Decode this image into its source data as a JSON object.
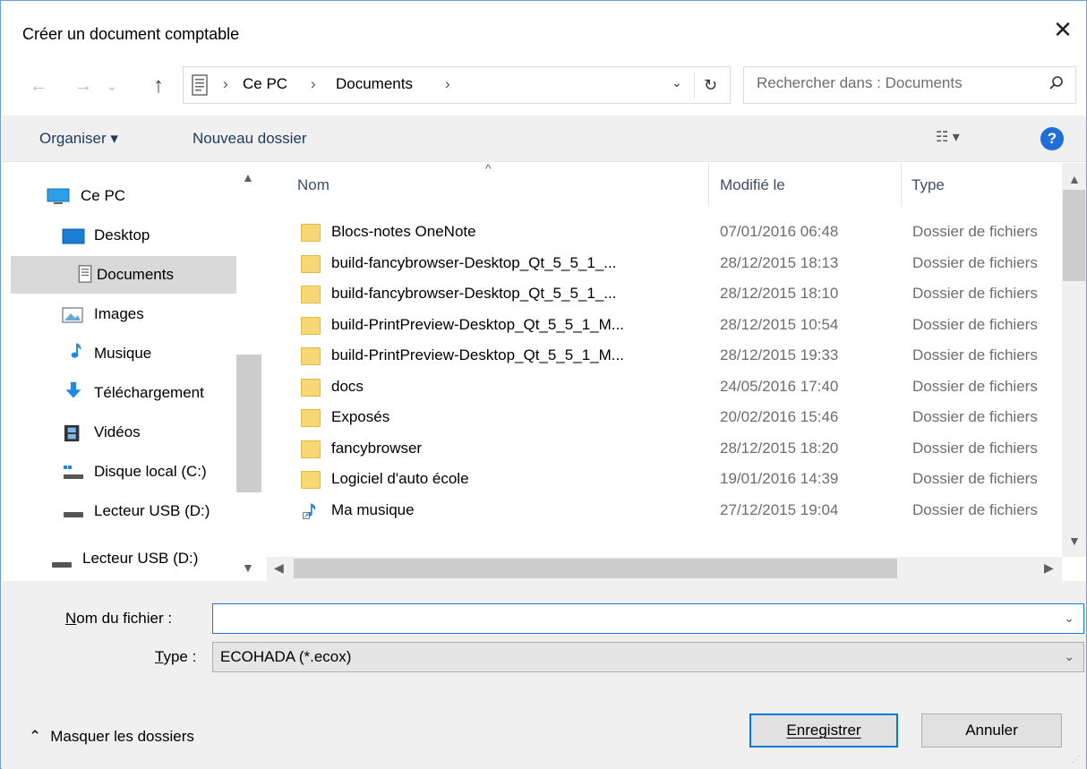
{
  "window": {
    "title": "Créer un document comptable",
    "close_glyph": "✕"
  },
  "nav": {
    "back_glyph": "←",
    "forward_glyph": "→",
    "recent_glyph": "⌄",
    "up_glyph": "↑"
  },
  "address": {
    "crumbs": [
      "Ce PC",
      "Documents"
    ],
    "separator": "›",
    "dropdown_glyph": "⌄",
    "refresh_glyph": "↻"
  },
  "search": {
    "placeholder": "Rechercher dans : Documents",
    "icon": "search-icon"
  },
  "toolbar": {
    "organize_label": "Organiser ▾",
    "new_folder_label": "Nouveau dossier",
    "view_glyph": "☷ ▾",
    "help_glyph": "?"
  },
  "sidebar": {
    "items": [
      {
        "label": "Ce PC",
        "icon": "computer-icon"
      },
      {
        "label": "Desktop",
        "icon": "desktop-icon"
      },
      {
        "label": "Documents",
        "icon": "documents-icon",
        "selected": true
      },
      {
        "label": "Images",
        "icon": "images-icon"
      },
      {
        "label": "Musique",
        "icon": "music-icon"
      },
      {
        "label": "Téléchargement",
        "icon": "download-icon"
      },
      {
        "label": "Vidéos",
        "icon": "videos-icon"
      },
      {
        "label": "Disque local (C:)",
        "icon": "local-disk-icon"
      },
      {
        "label": "Lecteur USB (D:)",
        "icon": "usb-drive-icon"
      },
      {
        "label": "Lecteur USB (D:)",
        "icon": "usb-drive-icon"
      }
    ]
  },
  "filelist": {
    "columns": {
      "name": "Nom",
      "modified": "Modifié le",
      "type": "Type"
    },
    "rows": [
      {
        "name": "Blocs-notes OneNote",
        "date": "07/01/2016 06:48",
        "type": "Dossier de fichiers",
        "icon": "folder-icon"
      },
      {
        "name": "build-fancybrowser-Desktop_Qt_5_5_1_...",
        "date": "28/12/2015 18:13",
        "type": "Dossier de fichiers",
        "icon": "folder-icon"
      },
      {
        "name": "build-fancybrowser-Desktop_Qt_5_5_1_...",
        "date": "28/12/2015 18:10",
        "type": "Dossier de fichiers",
        "icon": "folder-icon"
      },
      {
        "name": "build-PrintPreview-Desktop_Qt_5_5_1_M...",
        "date": "28/12/2015 10:54",
        "type": "Dossier de fichiers",
        "icon": "folder-icon"
      },
      {
        "name": "build-PrintPreview-Desktop_Qt_5_5_1_M...",
        "date": "28/12/2015 19:33",
        "type": "Dossier de fichiers",
        "icon": "folder-icon"
      },
      {
        "name": "docs",
        "date": "24/05/2016 17:40",
        "type": "Dossier de fichiers",
        "icon": "folder-icon"
      },
      {
        "name": "Exposés",
        "date": "20/02/2016 15:46",
        "type": "Dossier de fichiers",
        "icon": "folder-icon"
      },
      {
        "name": "fancybrowser",
        "date": "28/12/2015 18:20",
        "type": "Dossier de fichiers",
        "icon": "folder-icon"
      },
      {
        "name": "Logiciel d'auto école",
        "date": "19/01/2016 14:39",
        "type": "Dossier de fichiers",
        "icon": "folder-icon"
      },
      {
        "name": "Ma musique",
        "date": "27/12/2015 19:04",
        "type": "Dossier de fichiers",
        "icon": "music-shortcut-icon"
      }
    ]
  },
  "form": {
    "filename_label_accel": "N",
    "filename_label_rest": "om du fichier :",
    "filename_value": "",
    "type_label_accel": "T",
    "type_label_rest": "ype :",
    "type_value": "ECOHADA (*.ecox)",
    "dropdown_glyph": "⌄"
  },
  "footer": {
    "hide_folders_label": "Masquer les dossiers",
    "hide_folders_glyph": "⌃",
    "save_label": "Enregistrer",
    "cancel_label": "Annuler"
  }
}
